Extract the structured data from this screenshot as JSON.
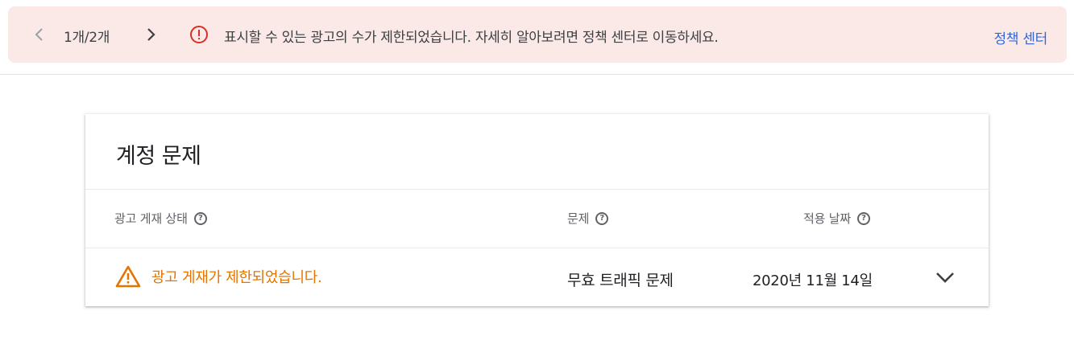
{
  "banner": {
    "pager": "1개/2개",
    "message": "표시할 수 있는 광고의 수가 제한되었습니다. 자세히 알아보려면 정책 센터로 이동하세요.",
    "policy_link": "정책 센터",
    "background_color": "#fbe9e7",
    "alert_color": "#d93025",
    "prev_icon": "chevron-left-icon",
    "next_icon": "chevron-right-icon",
    "alert_icon": "error-circle-icon"
  },
  "card": {
    "title": "계정 문제",
    "columns": {
      "status": "광고 게재 상태",
      "issue": "문제",
      "date": "적용 날짜"
    },
    "row": {
      "status": "광고 게재가 제한되었습니다.",
      "issue": "무효 트래픽 문제",
      "date": "2020년 11월 14일",
      "status_color": "#e37400",
      "warning_icon": "warning-triangle-icon",
      "expand_icon": "chevron-down-icon"
    }
  }
}
